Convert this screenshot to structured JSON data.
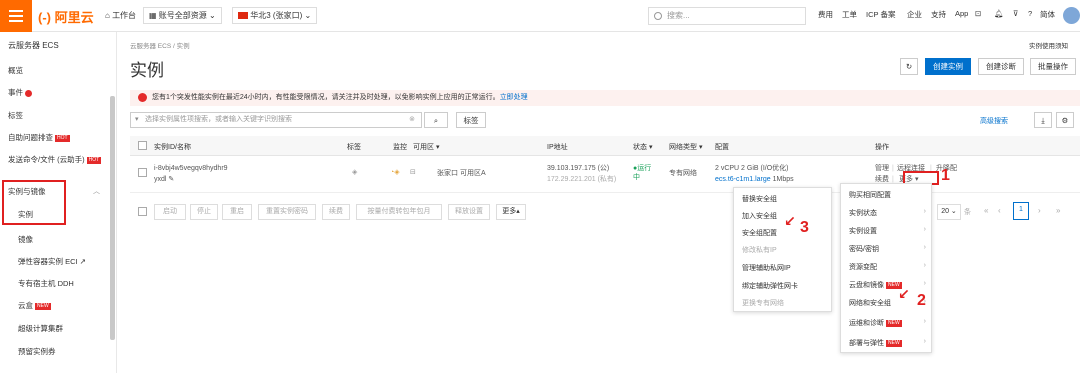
{
  "topbar": {
    "brand": "(-) 阿里云",
    "workbench": "工作台",
    "account_resources": "账号全部资源",
    "region": "华北3 (张家口)",
    "search_placeholder": "搜索...",
    "links": [
      "费用",
      "工单",
      "ICP 备案",
      "企业",
      "支持",
      "App"
    ],
    "lang": "简体"
  },
  "sidebar": {
    "title": "云服务器 ECS",
    "items": [
      "概览",
      "事件",
      "标签",
      "自助问题排查",
      "发送命令/文件 (云助手)",
      "实例与镜像",
      "实例",
      "镜像",
      "弹性容器实例 ECI",
      "专有宿主机 DDH",
      "云盒",
      "超级计算集群",
      "预留实例券"
    ],
    "hot": "HOT",
    "new": "NEW"
  },
  "main": {
    "breadcrumb": "云服务器 ECS / 实例",
    "title": "实例",
    "usage_link": "实例使用须知",
    "create_btn": "创建实例",
    "diagnose_btn": "创建诊断",
    "batch_btn": "批量操作",
    "notice": "您有1个突发性能实例在最近24小时内，有性能受限情况，请关注并及时处理，以免影响实例上应用的正常运行。",
    "notice_link": "立即处理",
    "filter_placeholder": "选择实例属性项搜索，或者输入关键字识别搜索",
    "tag_btn": "标签",
    "advanced_search": "高级搜索",
    "columns": [
      "实例ID/名称",
      "标签",
      "监控",
      "可用区",
      "IP地址",
      "状态",
      "网络类型",
      "配置",
      "操作"
    ],
    "row": {
      "id": "i-8vbj4w5vegqv8hydhr9",
      "name": "yxdl",
      "zone": "张家口 可用区A",
      "ip_public": "39.103.197.175 (公)",
      "ip_private": "172.29.221.201 (私有)",
      "status": "运行中",
      "network": "专有网络",
      "config": "2 vCPU 2 GiB (I/O优化)",
      "spec": "ecs.t6-c1m1.large",
      "bandwidth": "1Mbps",
      "op_manage": "管理",
      "op_remote": "远程连接",
      "op_upgrade": "升降配",
      "op_renew": "续费",
      "op_more": "更多"
    },
    "batch_buttons": [
      "启动",
      "停止",
      "重启",
      "重置实例密码",
      "续费",
      "按量付费转包年包月",
      "释放设置",
      "更多"
    ],
    "pagination": {
      "size": "20",
      "page": "1"
    }
  },
  "more_menu": [
    "购买相同配置",
    "实例状态",
    "实例设置",
    "密码/密钥",
    "资源变配",
    "云盘和镜像",
    "网络和安全组",
    "运维和诊断",
    "部署与弹性"
  ],
  "submenu": [
    "替换安全组",
    "加入安全组",
    "安全组配置",
    "修改私有IP",
    "管理辅助私网IP",
    "绑定辅助弹性网卡",
    "更换专有网络"
  ],
  "annotations": [
    "1",
    "2",
    "3"
  ],
  "colors": {
    "brand": "#ff6a00",
    "primary": "#0070cc",
    "annotation": "#e02020"
  }
}
